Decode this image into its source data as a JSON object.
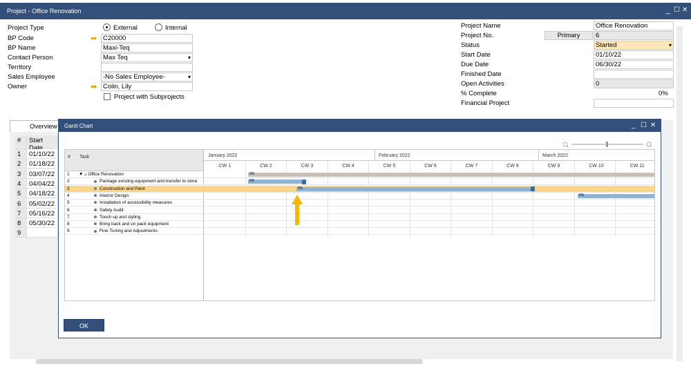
{
  "window": {
    "title": "Project - Office Renovation",
    "minimize": "_",
    "maximize": "☐",
    "close": "✕"
  },
  "left_form": {
    "project_type_label": "Project Type",
    "external_label": "External",
    "internal_label": "Internal",
    "bp_code_label": "BP Code",
    "bp_code": "C20000",
    "bp_name_label": "BP Name",
    "bp_name": "Maxi-Teq",
    "contact_label": "Contact Person",
    "contact": "Max Teq",
    "territory_label": "Territory",
    "territory": "",
    "sales_employee_label": "Sales Employee",
    "sales_employee": "-No Sales Employee-",
    "owner_label": "Owner",
    "owner": "Colin, Lily",
    "subprojects_label": "Project with Subprojects"
  },
  "right_form": {
    "project_name_label": "Project Name",
    "project_name": "Office Renovation",
    "project_no_label": "Project No.",
    "project_no_series": "Primary",
    "project_no": "6",
    "status_label": "Status",
    "status": "Started",
    "start_date_label": "Start Date",
    "start_date": "01/10/22",
    "due_date_label": "Due Date",
    "due_date": "06/30/22",
    "finished_date_label": "Finished Date",
    "finished_date": "",
    "open_activities_label": "Open Activities",
    "open_activities": "0",
    "complete_label": "% Complete",
    "complete": "0%",
    "financial_label": "Financial Project",
    "financial": ""
  },
  "background": {
    "tab_overview": "Overview",
    "col_num": "#",
    "col_start": "Start Date",
    "rows": [
      {
        "n": "1",
        "d": "01/10/22"
      },
      {
        "n": "2",
        "d": "01/18/22"
      },
      {
        "n": "3",
        "d": "03/07/22"
      },
      {
        "n": "4",
        "d": "04/04/22"
      },
      {
        "n": "5",
        "d": "04/18/22"
      },
      {
        "n": "6",
        "d": "05/02/22"
      },
      {
        "n": "7",
        "d": "05/16/22"
      },
      {
        "n": "8",
        "d": "05/30/22"
      },
      {
        "n": "9",
        "d": ""
      }
    ]
  },
  "gantt": {
    "title": "Gantt Chart",
    "col_num": "#",
    "col_task": "Task",
    "months": [
      "January 2022",
      "February 2022",
      "March 2022"
    ],
    "weeks": [
      "CW 1",
      "CW 2",
      "CW 3",
      "CW 4",
      "CW 5",
      "CW 6",
      "CW 7",
      "CW 8",
      "CW 9",
      "CW 10",
      "CW 11"
    ],
    "tasks": [
      {
        "n": "1",
        "name": "Office Renovation",
        "parent": true
      },
      {
        "n": "2",
        "name": "Package existing equipment and transfer to stora"
      },
      {
        "n": "3",
        "name": "Construction and Paint",
        "selected": true
      },
      {
        "n": "4",
        "name": "Interior Design"
      },
      {
        "n": "5",
        "name": "Installation of accessibility measures"
      },
      {
        "n": "6",
        "name": "Safety Audit"
      },
      {
        "n": "7",
        "name": "Touch up and styling"
      },
      {
        "n": "8",
        "name": "Bring back and un pack equipment"
      },
      {
        "n": "9",
        "name": "Fine Tuning and Adjustments"
      }
    ],
    "progress_label": "0%",
    "ok_label": "OK",
    "colors": {
      "header": "#32507a",
      "selected_row": "#fbd58a",
      "bar": "#8fb4d3",
      "summary_bar": "#c8c0b4",
      "arrow": "#f5b800"
    }
  }
}
